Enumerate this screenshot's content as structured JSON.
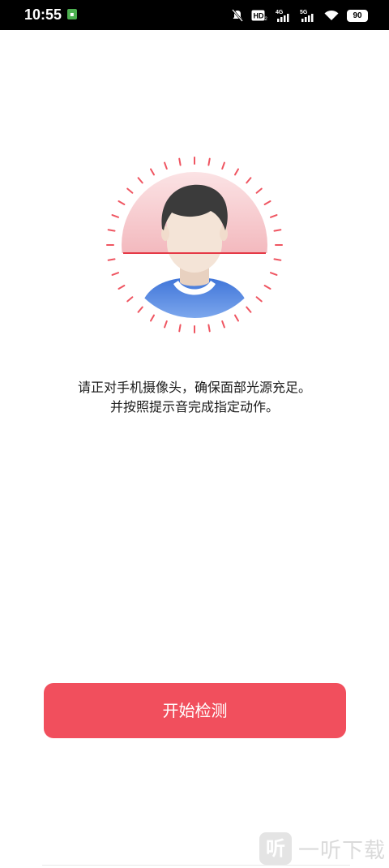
{
  "status_bar": {
    "time": "10:55",
    "app_notification_icon": "app-notification-icon",
    "icons": [
      "mute-icon",
      "hd-icon",
      "4g-signal-icon",
      "5g-signal-icon",
      "wifi-icon"
    ],
    "battery": "90"
  },
  "illustration": {
    "icon": "face-scan-icon",
    "colors": {
      "ring_dash": "#ef5561",
      "scan_line": "#e53946",
      "bg_gradient_top": "#fde4e6",
      "hair": "#3b3b3b",
      "skin": "#f3e3d6",
      "shirt": "#4f83df"
    }
  },
  "instructions": {
    "line1": "请正对手机摄像头，确保面部光源充足。",
    "line2": "并按照提示音完成指定动作。"
  },
  "start_button": {
    "label": "开始检测",
    "color": "#f14f5d"
  },
  "watermark": {
    "logo": "听",
    "text": "一听下载"
  }
}
